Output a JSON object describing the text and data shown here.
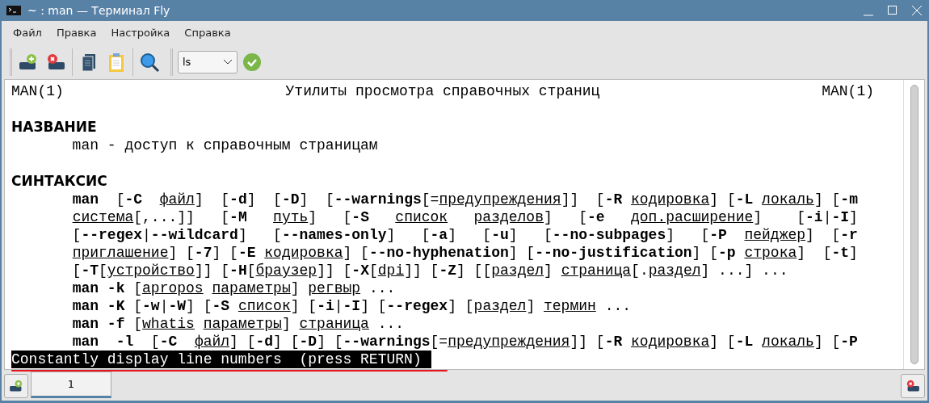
{
  "window": {
    "title": "~ : man — Терминал Fly"
  },
  "menu": [
    "Файл",
    "Правка",
    "Настройка",
    "Справка"
  ],
  "toolbar": {
    "command_combo": {
      "value": "ls"
    }
  },
  "terminal": {
    "header": {
      "left": "MAN(1)",
      "center": "Утилиты просмотра справочных страниц",
      "right": "MAN(1)"
    },
    "lines": [
      {
        "kind": "heading",
        "text": "НАЗВАНИЕ"
      },
      {
        "kind": "text",
        "text": "       man - доступ к справочным страницам"
      },
      {
        "kind": "heading",
        "text": "СИНТАКСИС"
      },
      {
        "kind": "text",
        "text": "       **man**  [**-C**  *файл*]  [**-d**]  [**-D**]  [**--warnings**[=*предупреждения*]]  [**-R** *кодировка*] [**-L** *локаль*] [**-m**"
      },
      {
        "kind": "text",
        "text": "       *система*[,...]]   [**-M**   *путь*]   [**-S**   *список*   *разделов*]   [**-e**   *доп.расширение*]    [**-i**|**-I**]"
      },
      {
        "kind": "text",
        "text": "       [**--regex**|**--wildcard**]   [**--names-only**]   [**-a**]   [**-u**]   [**--no-subpages**]   [**-P**  *пейджер*]  [**-r**"
      },
      {
        "kind": "text",
        "text": "       *приглашение*] [**-7**] [**-E** *кодировка*] [**--no-hyphenation**] [**--no-justification**] [**-p** *строка*]  [**-t**]"
      },
      {
        "kind": "text",
        "text": "       [**-T**[*устройство*]] [**-H**[*браузер*]] [**-X**[*dpi*]] [**-Z**] [[*раздел*] *страница*[.*раздел*] ...] ..."
      },
      {
        "kind": "text",
        "text": "       **man -k** [*apropos* *параметры*] *регвыр* ..."
      },
      {
        "kind": "text",
        "text": "       **man -K** [**-w**|**-W**] [**-S** *список*] [**-i**|**-I**] [**--regex**] [*раздел*] *термин* ..."
      },
      {
        "kind": "text",
        "text": "       **man -f** [*whatis* *параметры*] *страница* ..."
      },
      {
        "kind": "text",
        "text": "       **man  -l**  [**-C**  *файл*] [**-d**] [**-D**] [**--warnings**[=*предупреждения*]] [**-R** *кодировка*] [**-L** *локаль*] [**-P**"
      },
      {
        "kind": "prompt",
        "text": "Constantly display line numbers  (press RETURN)"
      }
    ]
  },
  "tabs": [
    {
      "label": "1",
      "selected": true
    }
  ]
}
